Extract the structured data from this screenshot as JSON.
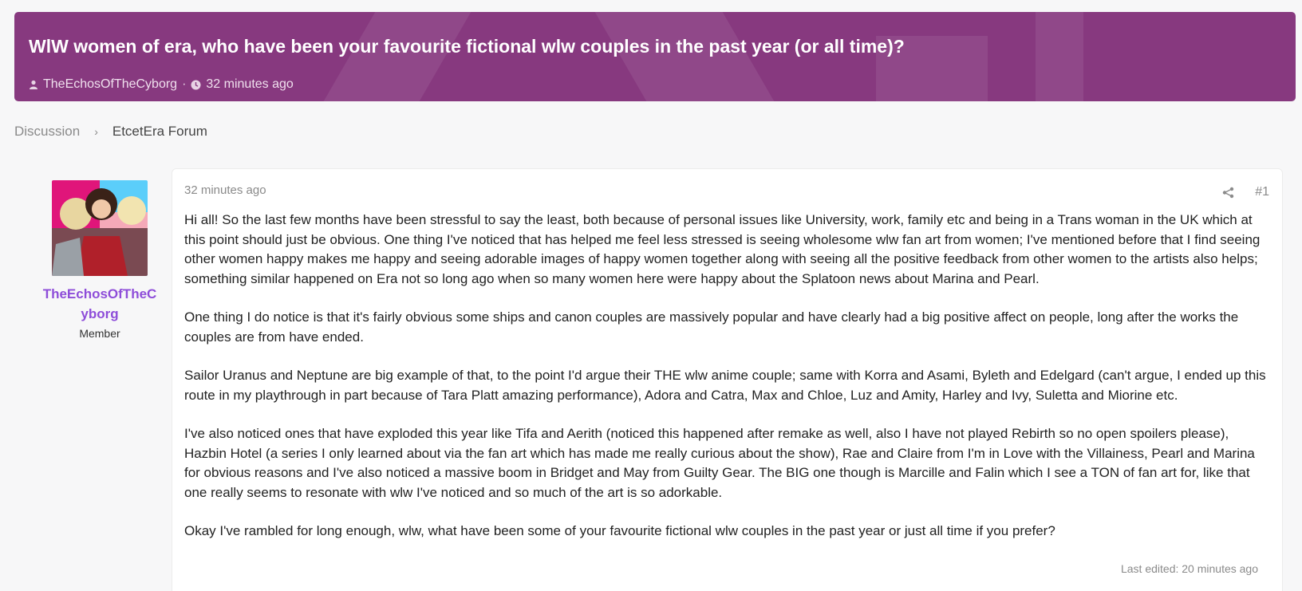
{
  "thread": {
    "title": "WlW women of era, who have been your favourite fictional wlw couples in the past year (or all time)?",
    "author": "TheEchosOfTheCyborg",
    "meta_separator": "·",
    "time": "32 minutes ago",
    "accent_color": "#87397f"
  },
  "breadcrumb": {
    "items": [
      "Discussion",
      "EtcetEra Forum"
    ],
    "separator": "›"
  },
  "user": {
    "name": "TheEchosOfTheCyborg",
    "title": "Member",
    "name_color": "#8e4dd9"
  },
  "post": {
    "time": "32 minutes ago",
    "post_number": "#1",
    "share_icon": "share-icon",
    "paragraphs": [
      "Hi all! So the last few months have been stressful to say the least, both because of personal issues like University, work, family etc and being in a Trans woman in the UK which at this point should just be obvious. One thing I've noticed that has helped me feel less stressed is seeing wholesome wlw fan art from women; I've mentioned before that I find seeing other women happy makes me happy and seeing adorable images of happy women together along with seeing all the positive feedback from other women to the artists also helps; something similar happened on Era not so long ago when so many women here were happy about the Splatoon news about Marina and Pearl.",
      "One thing I do notice is that it's fairly obvious some ships and canon couples are massively popular and have clearly had a big positive affect on people, long after the works the couples are from have ended.",
      "Sailor Uranus and Neptune are big example of that, to the point I'd argue their THE wlw anime couple; same with Korra and Asami, Byleth and Edelgard (can't argue, I ended up this route in my playthrough in part because of Tara Platt amazing performance), Adora and Catra, Max and Chloe, Luz and Amity, Harley and Ivy, Suletta and Miorine etc.",
      "I've also noticed ones that have exploded this year like Tifa and Aerith (noticed this happened after remake as well, also I have not played Rebirth so no open spoilers please), Hazbin Hotel (a series I only learned about via the fan art which has made me really curious about the show), Rae and Claire from I'm in Love with the Villainess, Pearl and Marina for obvious reasons and I've also noticed a massive boom in Bridget and May from Guilty Gear. The BIG one though is Marcille and Falin which I see a TON of fan art for, like that one really seems to resonate with wlw I've noticed and so much of the art is so adorkable.",
      "Okay I've rambled for long enough, wlw, what have been some of your favourite fictional wlw couples in the past year or just all time if you prefer?"
    ],
    "last_edited": "Last edited: 20 minutes ago"
  }
}
